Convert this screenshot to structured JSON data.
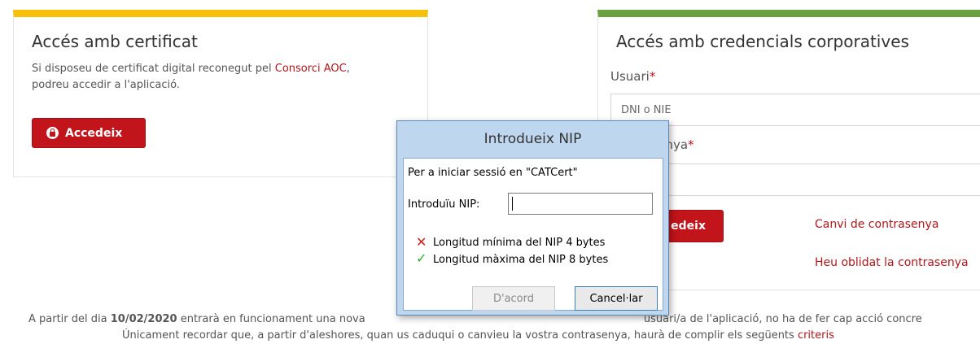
{
  "cert_card": {
    "title": "Accés amb certificat",
    "text_before_link": "Si disposeu de certificat digital reconegut pel ",
    "link": "Consorci AOC",
    "text_after_link": ",",
    "text_line2": "podreu accedir a l'aplicació.",
    "button_label": "Accedeix"
  },
  "cred_card": {
    "title": "Accés amb credencials corporatives",
    "user_label": "Usuari",
    "required_mark": "*",
    "user_placeholder": "DNI o NIE",
    "password_label_visible": "nya",
    "button_label_visible": "edeix",
    "change_password_link": "Canvi de contrasenya",
    "forgot_password_link": "Heu oblidat la contrasenya"
  },
  "footer": {
    "line1_start": "A partir del dia ",
    "line1_date": "10/02/2020",
    "line1_mid": " entrarà en funcionament una nova ",
    "line1_end": "usuari/a de l'aplicació, no ha de fer cap acció concre",
    "line2_text": "Únicament recordar que, a partir d'aleshores, quan us caduqui o canvieu la vostra contrasenya, haurà de complir els següents ",
    "line2_link": "criteris"
  },
  "dialog": {
    "title": "Introdueix NIP",
    "message": "Per a iniciar sessió en \"CATCert\"",
    "nip_label": "Introduïu NIP:",
    "nip_value": "",
    "rules": [
      {
        "icon": "cross-icon",
        "text": "Longitud mínima del NIP 4 bytes"
      },
      {
        "icon": "check-icon",
        "text": "Longitud màxima del NIP 8 bytes"
      }
    ],
    "ok_label": "D'acord",
    "cancel_label": "Cancel·lar"
  },
  "colors": {
    "cert_accent": "#f7c10b",
    "cred_accent": "#6aa242",
    "brand_red": "#c1141b",
    "dialog_frame": "#bed6ee"
  }
}
